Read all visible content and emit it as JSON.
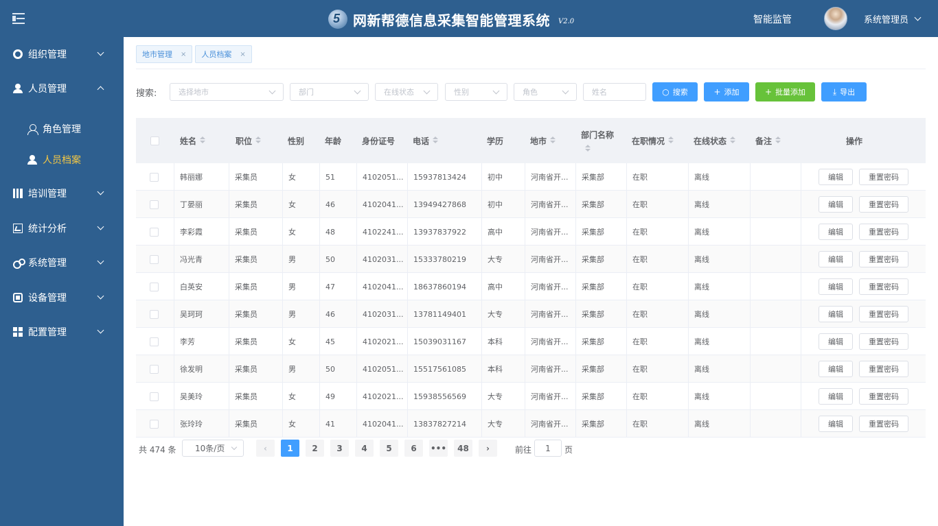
{
  "header": {
    "title": "网新帮德信息采集智能管理系统",
    "version": "V2.0",
    "monitor_label": "智能监管",
    "user_name": "系统管理员"
  },
  "sidebar": {
    "items": [
      {
        "label": "组织管理",
        "icon": "gear-icon"
      },
      {
        "label": "人员管理",
        "icon": "user-icon"
      },
      {
        "label": "培训管理",
        "icon": "books-icon"
      },
      {
        "label": "统计分析",
        "icon": "chart-icon"
      },
      {
        "label": "系统管理",
        "icon": "cogs-icon"
      },
      {
        "label": "设备管理",
        "icon": "chip-icon"
      },
      {
        "label": "配置管理",
        "icon": "grid-icon"
      }
    ],
    "sub_items": [
      {
        "label": "角色管理"
      },
      {
        "label": "人员档案"
      }
    ],
    "active_color": "#f5c844"
  },
  "tabs": [
    {
      "label": "地市管理",
      "close": "×"
    },
    {
      "label": "人员档案",
      "close": "×"
    }
  ],
  "search": {
    "label": "搜索:",
    "city_placeholder": "选择地市",
    "dept_placeholder": "部门",
    "status_placeholder": "在线状态",
    "gender_placeholder": "性别",
    "role_placeholder": "角色",
    "name_placeholder": "姓名",
    "search_btn": "搜索",
    "add_btn": "添加",
    "batch_add_btn": "批量添加",
    "export_btn": "导出"
  },
  "table": {
    "headers": {
      "name": "姓名",
      "position": "职位",
      "gender": "性别",
      "age": "年龄",
      "id_card": "身份证号",
      "phone": "电话",
      "education": "学历",
      "city": "地市",
      "dept": "部门名称",
      "job_status": "在职情况",
      "online_status": "在线状态",
      "remark": "备注",
      "action": "操作"
    },
    "edit_label": "编辑",
    "reset_label": "重置密码",
    "rows": [
      {
        "name": "韩丽娜",
        "position": "采集员",
        "gender": "女",
        "age": "51",
        "id_card": "4102051...",
        "phone": "15937813424",
        "education": "初中",
        "city": "河南省开...",
        "dept": "采集部",
        "job_status": "在职",
        "online_status": "离线",
        "remark": ""
      },
      {
        "name": "丁晏丽",
        "position": "采集员",
        "gender": "女",
        "age": "46",
        "id_card": "4102041...",
        "phone": "13949427868",
        "education": "初中",
        "city": "河南省开...",
        "dept": "采集部",
        "job_status": "在职",
        "online_status": "离线",
        "remark": ""
      },
      {
        "name": "李彩霞",
        "position": "采集员",
        "gender": "女",
        "age": "48",
        "id_card": "4102241...",
        "phone": "13937837922",
        "education": "高中",
        "city": "河南省开...",
        "dept": "采集部",
        "job_status": "在职",
        "online_status": "离线",
        "remark": ""
      },
      {
        "name": "冯光青",
        "position": "采集员",
        "gender": "男",
        "age": "50",
        "id_card": "4102031...",
        "phone": "15333780219",
        "education": "大专",
        "city": "河南省开...",
        "dept": "采集部",
        "job_status": "在职",
        "online_status": "离线",
        "remark": ""
      },
      {
        "name": "白英安",
        "position": "采集员",
        "gender": "男",
        "age": "47",
        "id_card": "4102041...",
        "phone": "18637860194",
        "education": "高中",
        "city": "河南省开...",
        "dept": "采集部",
        "job_status": "在职",
        "online_status": "离线",
        "remark": ""
      },
      {
        "name": "吴珂珂",
        "position": "采集员",
        "gender": "男",
        "age": "46",
        "id_card": "4102031...",
        "phone": "13781149401",
        "education": "大专",
        "city": "河南省开...",
        "dept": "采集部",
        "job_status": "在职",
        "online_status": "离线",
        "remark": ""
      },
      {
        "name": "李芳",
        "position": "采集员",
        "gender": "女",
        "age": "45",
        "id_card": "4102021...",
        "phone": "15039031167",
        "education": "本科",
        "city": "河南省开...",
        "dept": "采集部",
        "job_status": "在职",
        "online_status": "离线",
        "remark": ""
      },
      {
        "name": "徐发明",
        "position": "采集员",
        "gender": "男",
        "age": "50",
        "id_card": "4102051...",
        "phone": "15517561085",
        "education": "本科",
        "city": "河南省开...",
        "dept": "采集部",
        "job_status": "在职",
        "online_status": "离线",
        "remark": ""
      },
      {
        "name": "吴美玲",
        "position": "采集员",
        "gender": "女",
        "age": "49",
        "id_card": "4102021...",
        "phone": "15938556569",
        "education": "大专",
        "city": "河南省开...",
        "dept": "采集部",
        "job_status": "在职",
        "online_status": "离线",
        "remark": ""
      },
      {
        "name": "张玲玲",
        "position": "采集员",
        "gender": "女",
        "age": "41",
        "id_card": "4102041...",
        "phone": "13837827214",
        "education": "大专",
        "city": "河南省开...",
        "dept": "采集部",
        "job_status": "在职",
        "online_status": "离线",
        "remark": ""
      }
    ]
  },
  "pagination": {
    "total_text": "共 474 条",
    "page_size": "10条/页",
    "prev": "‹",
    "next": "›",
    "pages": [
      "1",
      "2",
      "3",
      "4",
      "5",
      "6",
      "•••",
      "48"
    ],
    "current_page": "1",
    "goto_prefix": "前往",
    "goto_value": "1",
    "goto_suffix": "页"
  }
}
